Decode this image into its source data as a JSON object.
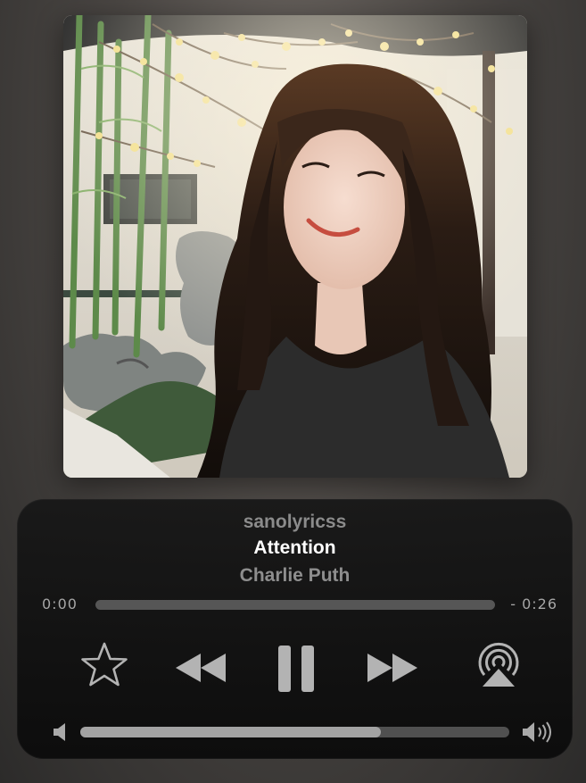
{
  "now_playing": {
    "source": "sanolyricss",
    "title": "Attention",
    "artist": "Charlie Puth",
    "elapsed": "0:00",
    "remaining": "- 0:26",
    "progress_fraction": 0.0,
    "volume_fraction": 0.7
  },
  "controls": {
    "favorite_icon": "star-outline-icon",
    "previous_icon": "rewind-icon",
    "play_pause_icon": "pause-icon",
    "next_icon": "fast-forward-icon",
    "airplay_icon": "airplay-icon",
    "volume_low_icon": "speaker-low-icon",
    "volume_high_icon": "speaker-high-icon"
  },
  "colors": {
    "panel_background": "#141414",
    "title_text": "#ffffff",
    "secondary_text": "#8e8e8e",
    "control_icon": "#b0b0b0",
    "progress_track": "#565656",
    "volume_fill": "#a3a3a3"
  }
}
